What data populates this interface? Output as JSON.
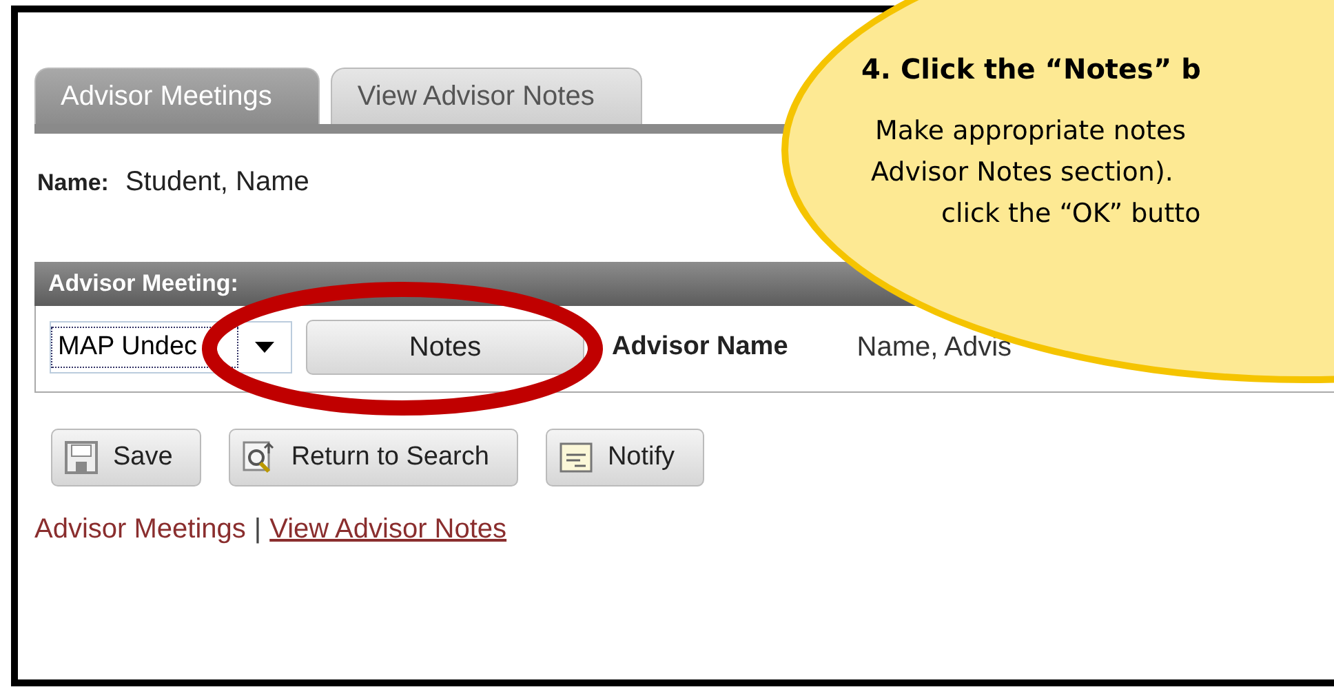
{
  "tabs": [
    {
      "label": "Advisor Meetings",
      "selected": true
    },
    {
      "label": "View Advisor Notes",
      "selected": false
    }
  ],
  "name_field": {
    "label": "Name:",
    "value": "Student, Name"
  },
  "meeting_section": {
    "title": "Advisor Meeting:",
    "dropdown_value": "MAP Undec",
    "notes_button": "Notes",
    "advisor_label": "Advisor Name",
    "advisor_value": "Name, Advis"
  },
  "toolbar": [
    {
      "kind": "save",
      "label": "Save"
    },
    {
      "kind": "search",
      "label": "Return to Search"
    },
    {
      "kind": "notify",
      "label": "Notify"
    }
  ],
  "links": [
    {
      "label": "Advisor Meetings",
      "selected": true
    },
    {
      "label": "View Advisor Notes",
      "selected": false
    }
  ],
  "link_separator": "|",
  "callout": {
    "heading": "4. Click the “Notes” b",
    "lines": [
      "Make appropriate notes",
      "Advisor Notes section). ",
      "click the “OK” butto"
    ]
  }
}
